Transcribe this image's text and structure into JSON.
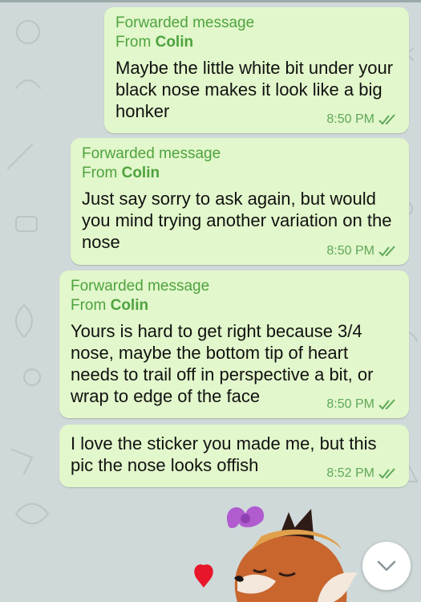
{
  "colors": {
    "background": "#cfd9d9",
    "bubble": "#e2f7cb",
    "forward_label": "#4ea33f",
    "meta": "#5fa85a"
  },
  "messages": [
    {
      "forward_label": "Forwarded message",
      "from_prefix": "From",
      "from_name": "Colin",
      "text": "Maybe the little white bit under your black nose makes it look like a big honker",
      "time": "8:50 PM",
      "status_icon": "double-check-icon"
    },
    {
      "forward_label": "Forwarded message",
      "from_prefix": "From",
      "from_name": "Colin",
      "text": "Just say sorry to ask again, but would you mind trying another variation on the nose",
      "time": "8:50 PM",
      "status_icon": "double-check-icon"
    },
    {
      "forward_label": "Forwarded message",
      "from_prefix": "From",
      "from_name": "Colin",
      "text": "Yours is hard to get right because 3/4 nose, maybe the bottom tip of heart needs to trail off in perspective a bit, or wrap to edge of the face",
      "time": "8:50 PM",
      "status_icon": "double-check-icon"
    },
    {
      "text": "I love the sticker you made me, but this pic the nose looks offish",
      "time": "8:52 PM",
      "status_icon": "double-check-icon"
    }
  ],
  "sticker": {
    "icon": "fox-girl-sticker-icon"
  },
  "scroll_button": {
    "icon": "chevron-down-icon"
  }
}
